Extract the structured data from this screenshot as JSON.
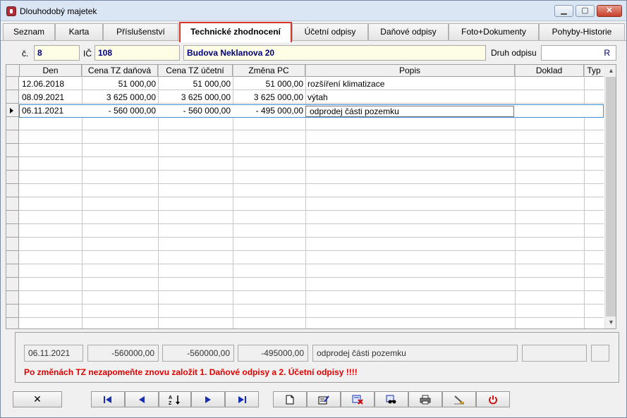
{
  "window": {
    "title": "Dlouhodobý majetek",
    "controls": [
      "minimize",
      "maximize",
      "close"
    ]
  },
  "tabs": [
    {
      "label": "Seznam",
      "active": false
    },
    {
      "label": "Karta",
      "active": false
    },
    {
      "label": "Příslušenství",
      "active": false
    },
    {
      "label": "Technické zhodnocení",
      "active": true
    },
    {
      "label": "Účetní odpisy",
      "active": false
    },
    {
      "label": "Daňové odpisy",
      "active": false
    },
    {
      "label": "Foto+Dokumenty",
      "active": false
    },
    {
      "label": "Pohyby-Historie",
      "active": false
    }
  ],
  "header": {
    "cislo_label": "č.",
    "cislo_value": "8",
    "ic_label": "IČ",
    "ic_value": "108",
    "name_value": "Budova Neklanova 20",
    "druh_label": "Druh odpisu",
    "druh_value": "R"
  },
  "grid": {
    "columns": [
      "Den",
      "Cena TZ daňová",
      "Cena TZ účetní",
      "Změna PC",
      "Popis",
      "Doklad",
      "Typ"
    ],
    "rows": [
      {
        "den": "12.06.2018",
        "cena_danova": "51 000,00",
        "cena_ucetni": "51 000,00",
        "zmena_pc": "51 000,00",
        "popis": "rozšíření klimatizace",
        "doklad": "",
        "typ": ""
      },
      {
        "den": "08.09.2021",
        "cena_danova": "3 625 000,00",
        "cena_ucetni": "3 625 000,00",
        "zmena_pc": "3 625 000,00",
        "popis": "výtah",
        "doklad": "",
        "typ": ""
      },
      {
        "den": "06.11.2021",
        "cena_danova": "- 560 000,00",
        "cena_ucetni": "- 560 000,00",
        "zmena_pc": "- 495 000,00",
        "popis": "odprodej části pozemku",
        "doklad": "",
        "typ": ""
      }
    ],
    "selected_row": 2
  },
  "detail": {
    "den": "06.11.2021",
    "cena_danova": "-560000,00",
    "cena_ucetni": "-560000,00",
    "zmena_pc": "-495000,00",
    "popis": "odprodej části pozemku",
    "doklad": "",
    "typ": ""
  },
  "warning": "Po změnách TZ nezapomeňte znovu založit 1. Daňové odpisy a 2. Účetní odpisy !!!!",
  "toolbar": {
    "cancel_label": "✕",
    "icons": [
      "first-icon",
      "prev-icon",
      "sort-az-icon",
      "next-icon",
      "last-icon",
      "new-document-icon",
      "edit-icon",
      "delete-icon",
      "search-icon",
      "print-icon",
      "settings-icon",
      "power-icon"
    ]
  },
  "colors": {
    "accent": "#d9342b",
    "field_bg": "#fcfde4",
    "field_text": "#000080",
    "warning_text": "#e00000",
    "selection_border": "#3b8fd6"
  }
}
